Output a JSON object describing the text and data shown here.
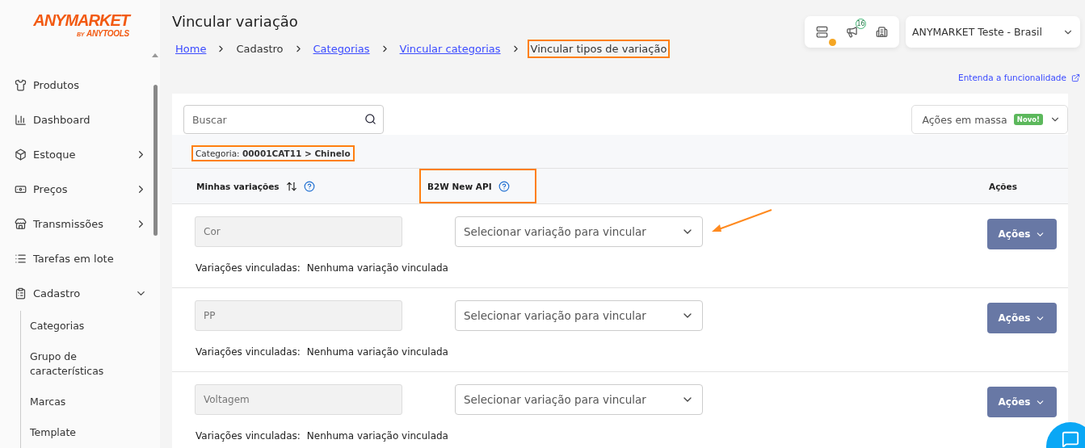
{
  "logo": {
    "name": "ANYMARKET",
    "by": "BY",
    "brand": "ANYTOOLS"
  },
  "sidebar": {
    "items": [
      {
        "label": "Produtos"
      },
      {
        "label": "Dashboard"
      },
      {
        "label": "Estoque",
        "expanded": false
      },
      {
        "label": "Preços",
        "expanded": false
      },
      {
        "label": "Transmissões",
        "expanded": false
      },
      {
        "label": "Tarefas em lote"
      },
      {
        "label": "Cadastro",
        "expanded": true,
        "children": [
          {
            "label": "Categorias"
          },
          {
            "label": "Grupo de características"
          },
          {
            "label": "Marcas"
          },
          {
            "label": "Template"
          }
        ]
      }
    ]
  },
  "page_title": "Vincular variação",
  "breadcrumb": [
    {
      "label": "Home",
      "link": true,
      "highlighted": false
    },
    {
      "label": "Cadastro",
      "link": false,
      "highlighted": false
    },
    {
      "label": "Categorias",
      "link": true,
      "highlighted": false
    },
    {
      "label": "Vincular categorias",
      "link": true,
      "highlighted": false
    },
    {
      "label": "Vincular tipos de variação",
      "link": false,
      "highlighted": true
    }
  ],
  "header": {
    "notification_count": "16",
    "account": "ANYMARKET Teste - Brasil"
  },
  "help_link": "Entenda a funcionalidade",
  "search": {
    "placeholder": "Buscar"
  },
  "bulk_actions": {
    "label": "Ações em massa",
    "badge": "Novo!"
  },
  "category": {
    "label": "Categoria:",
    "value": "00001CAT11 > Chinelo",
    "highlighted": true
  },
  "table": {
    "columns": [
      {
        "label": "Minhas variações",
        "sortable": true,
        "help": true
      },
      {
        "label": "B2W New API",
        "help": true,
        "highlighted": true
      },
      {
        "label": "Ações"
      }
    ],
    "rows": [
      {
        "name": "Cor",
        "select_placeholder": "Selecionar variação para vincular",
        "linked_label": "Variações vinculadas:",
        "linked_value": "Nenhuma variação vinculada",
        "action": "Ações",
        "arrow": true
      },
      {
        "name": "PP",
        "select_placeholder": "Selecionar variação para vincular",
        "linked_label": "Variações vinculadas:",
        "linked_value": "Nenhuma variação vinculada",
        "action": "Ações"
      },
      {
        "name": "Voltagem",
        "select_placeholder": "Selecionar variação para vincular",
        "linked_label": "Variações vinculadas:",
        "linked_value": "Nenhuma variação vinculada",
        "action": "Ações"
      }
    ]
  }
}
